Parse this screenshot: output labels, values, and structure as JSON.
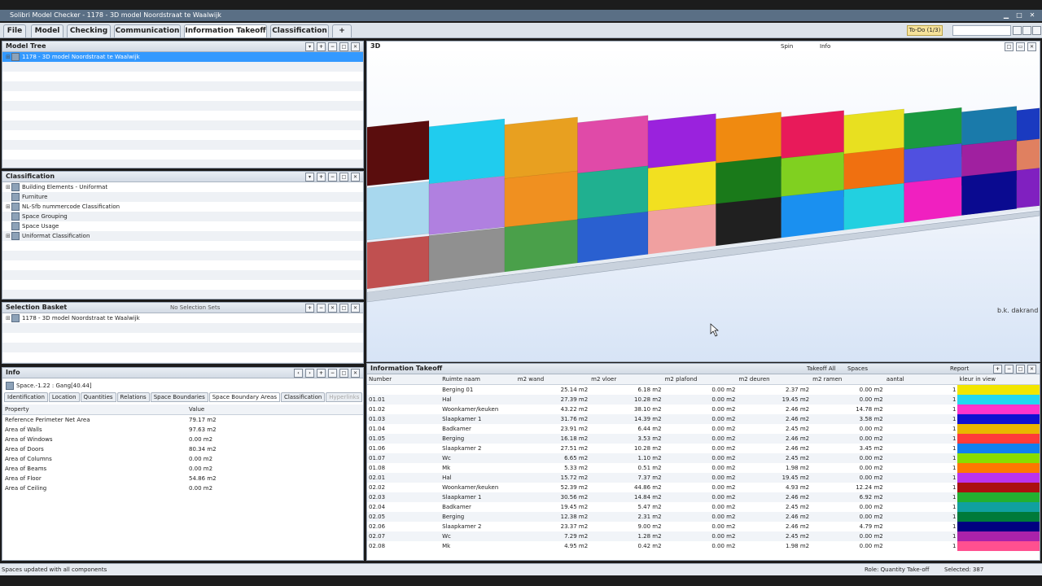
{
  "window": {
    "title": "Solibri Model Checker - 1178 - 3D model Noordstraat te Waalwijk"
  },
  "menu": {
    "tabs": [
      "File",
      "Model",
      "Checking",
      "Communication",
      "Information Takeoff",
      "Classification",
      "+"
    ],
    "todo": "To-Do (1/3)"
  },
  "model_tree": {
    "title": "Model Tree",
    "items": [
      "1178 - 3D model Noordstraat te Waalwijk"
    ]
  },
  "classification": {
    "title": "Classification",
    "items": [
      "Building Elements - Uniformat",
      "Furniture",
      "NL-Sfb nummercode Classification",
      "Space Grouping",
      "Space Usage",
      "Uniformat Classification"
    ]
  },
  "selection_basket": {
    "title": "Selection Basket",
    "sets_label": "No Selection Sets",
    "items": [
      "1178 - 3D model Noordstraat te Waalwijk"
    ]
  },
  "info": {
    "title": "Info",
    "object": "Space.-1.22 : Gang[40.44]",
    "tabs": [
      "Identification",
      "Location",
      "Quantities",
      "Relations",
      "Space Boundaries",
      "Space Boundary Areas",
      "Classification",
      "Hyperlinks"
    ],
    "headers": [
      "Property",
      "Value"
    ],
    "rows": [
      [
        "Reference Perimeter Net Area",
        "79.17 m2"
      ],
      [
        "Area of Walls",
        "97.63 m2"
      ],
      [
        "Area of Windows",
        "0.00 m2"
      ],
      [
        "Area of Doors",
        "80.34 m2"
      ],
      [
        "Area of Columns",
        "0.00 m2"
      ],
      [
        "Area of Beams",
        "0.00 m2"
      ],
      [
        "Area of Floor",
        "54.86 m2"
      ],
      [
        "Area of Ceiling",
        "0.00 m2"
      ]
    ]
  },
  "viewport": {
    "title": "3D",
    "toolbar": {
      "spin": "Spin",
      "info": "Info"
    },
    "label": "b.k. dakrand"
  },
  "takeoff": {
    "title": "Information Takeoff",
    "toolbar": {
      "takeoff_all": "Takeoff All",
      "spaces": "Spaces",
      "report": "Report"
    },
    "headers": [
      "Number",
      "Ruimte naam",
      "m2 wand",
      "m2 vloer",
      "m2 plafond",
      "m2 deuren",
      "m2 ramen",
      "aantal",
      "kleur in view"
    ],
    "rows": [
      [
        "",
        "Berging 01",
        "25.14 m2",
        "6.18 m2",
        "0.00 m2",
        "2.37 m2",
        "0.00 m2",
        "1",
        "#f2e600"
      ],
      [
        "01.01",
        "Hal",
        "27.39 m2",
        "10.28 m2",
        "0.00 m2",
        "19.45 m2",
        "0.00 m2",
        "1",
        "#22d8f0"
      ],
      [
        "01.02",
        "Woonkamer/keuken",
        "43.22 m2",
        "38.10 m2",
        "0.00 m2",
        "2.46 m2",
        "14.78 m2",
        "1",
        "#ff33cc"
      ],
      [
        "01.03",
        "Slaapkamer 1",
        "31.76 m2",
        "14.39 m2",
        "0.00 m2",
        "2.46 m2",
        "3.58 m2",
        "1",
        "#1010d0"
      ],
      [
        "01.04",
        "Badkamer",
        "23.91 m2",
        "6.44 m2",
        "0.00 m2",
        "2.45 m2",
        "0.00 m2",
        "1",
        "#e8b600"
      ],
      [
        "01.05",
        "Berging",
        "16.18 m2",
        "3.53 m2",
        "0.00 m2",
        "2.46 m2",
        "0.00 m2",
        "1",
        "#ff3a3a"
      ],
      [
        "01.06",
        "Slaapkamer 2",
        "27.51 m2",
        "10.28 m2",
        "0.00 m2",
        "2.46 m2",
        "3.45 m2",
        "1",
        "#1080f0"
      ],
      [
        "01.07",
        "Wc",
        "6.65 m2",
        "1.10 m2",
        "0.00 m2",
        "2.45 m2",
        "0.00 m2",
        "1",
        "#88dd00"
      ],
      [
        "01.08",
        "Mk",
        "5.33 m2",
        "0.51 m2",
        "0.00 m2",
        "1.98 m2",
        "0.00 m2",
        "1",
        "#ff7700"
      ],
      [
        "02.01",
        "Hal",
        "15.72 m2",
        "7.37 m2",
        "0.00 m2",
        "19.45 m2",
        "0.00 m2",
        "1",
        "#bb33ee"
      ],
      [
        "02.02",
        "Woonkamer/keuken",
        "52.39 m2",
        "44.86 m2",
        "0.00 m2",
        "4.93 m2",
        "12.24 m2",
        "1",
        "#aa1010"
      ],
      [
        "02.03",
        "Slaapkamer 1",
        "30.56 m2",
        "14.84 m2",
        "0.00 m2",
        "2.46 m2",
        "6.92 m2",
        "1",
        "#22b030"
      ],
      [
        "02.04",
        "Badkamer",
        "19.45 m2",
        "5.47 m2",
        "0.00 m2",
        "2.45 m2",
        "0.00 m2",
        "1",
        "#10a0a0"
      ],
      [
        "02.05",
        "Berging",
        "12.38 m2",
        "2.31 m2",
        "0.00 m2",
        "2.46 m2",
        "0.00 m2",
        "1",
        "#007a3a"
      ],
      [
        "02.06",
        "Slaapkamer 2",
        "23.37 m2",
        "9.00 m2",
        "0.00 m2",
        "2.46 m2",
        "4.79 m2",
        "1",
        "#000080"
      ],
      [
        "02.07",
        "Wc",
        "7.29 m2",
        "1.28 m2",
        "0.00 m2",
        "2.45 m2",
        "0.00 m2",
        "1",
        "#aa22aa"
      ],
      [
        "02.08",
        "Mk",
        "4.95 m2",
        "0.42 m2",
        "0.00 m2",
        "1.98 m2",
        "0.00 m2",
        "1",
        "#ff5090"
      ]
    ]
  },
  "status": {
    "left": "Spaces updated with all components",
    "role": "Role: Quantity Take-off",
    "selected": "Selected: 387"
  },
  "blocks": {
    "top": [
      "#5a0d0d",
      "#20ccee",
      "#e8a020",
      "#e04aa8",
      "#9a22dd",
      "#f08a10",
      "#e81a5a",
      "#e8e020",
      "#1a9a40",
      "#1a7aaa",
      "#1a3ac0",
      "#5050ee",
      "#d040cc",
      "#8abf40",
      "#1a5a2a",
      "#60a0c0",
      "#1a5050",
      "#20a080",
      "#c04080",
      "#20c070"
    ],
    "mid": [
      "#a8d8ee",
      "#b080e0",
      "#f09020",
      "#20b090",
      "#f2e020",
      "#1a7a1a",
      "#80d020",
      "#f07010",
      "#5050e0",
      "#a020a0",
      "#e08060",
      "#707070",
      "#30b0b0",
      "#2a8a6a",
      "#806090",
      "#20a0b0",
      "#a03050",
      "#c02080",
      "#3030c0",
      "#e040a0"
    ],
    "bot": [
      "#c05050",
      "#909090",
      "#4aa04a",
      "#2a60d0",
      "#f0a0a0",
      "#202020",
      "#1a90f0",
      "#22d0e0",
      "#f020c0",
      "#0a0a90",
      "#8020c0",
      "#b01010",
      "#d0c020",
      "#e0e020",
      "#40b040",
      "#1a8080",
      "#3030a0",
      "#207050",
      "#a06020",
      "#6020a0"
    ]
  }
}
